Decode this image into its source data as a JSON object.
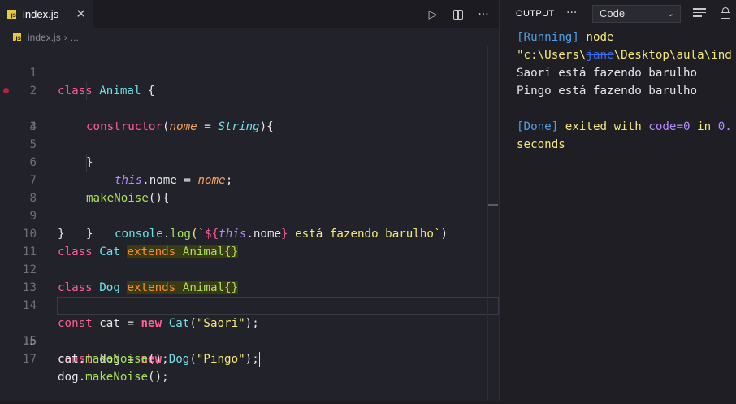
{
  "editor": {
    "tab": {
      "title": "index.js",
      "icon": "JS",
      "close": "✕"
    },
    "actions": {
      "run": "▷",
      "more": "···"
    },
    "breadcrumb": {
      "file": "index.js",
      "sep": "›",
      "trail": "..."
    },
    "line_numbers": [
      "1",
      "2",
      "3",
      "4",
      "5",
      "6",
      "7",
      "8",
      "9",
      "10",
      "11",
      "12",
      "13",
      "14",
      "15",
      "16",
      "17"
    ]
  },
  "code": {
    "l1": [
      "class",
      " ",
      "Animal",
      " {"
    ],
    "l2": [
      "constructor",
      "(",
      "nome",
      " = ",
      "String",
      "){"
    ],
    "l3": [
      "this",
      ".nome = ",
      "nome",
      ";"
    ],
    "l4": [
      "}"
    ],
    "l6": [
      "makeNoise",
      "(){"
    ],
    "l7": [
      "console",
      ".",
      "log",
      "(`",
      "${",
      "this",
      ".nome",
      "}",
      " está fazendo barulho`",
      ")"
    ],
    "l8": [
      "}"
    ],
    "l9": [
      "}"
    ],
    "l10": [
      "class",
      " ",
      "Cat",
      " ",
      "extends",
      " ",
      "Animal",
      "{}"
    ],
    "l12": [
      "class",
      " ",
      "Dog",
      " ",
      "extends",
      " ",
      "Animal",
      "{}"
    ],
    "l14": [
      "const",
      " ",
      "cat",
      " = ",
      "new",
      " ",
      "Cat",
      "(",
      "\"Saori\"",
      ");"
    ],
    "l15": [
      "const",
      " ",
      "dog",
      " = ",
      "new",
      " ",
      "Dog",
      "(",
      "\"Pingo\"",
      ");"
    ],
    "l16": [
      "cat",
      ".",
      "makeNoise",
      "();"
    ],
    "l17": [
      "dog",
      ".",
      "makeNoise",
      "();"
    ]
  },
  "output": {
    "tab_label": "OUTPUT",
    "more": "···",
    "channel": "Code",
    "running_tag": "[Running]",
    "running_cmd": " node",
    "path_start": "\"c:\\Users\\",
    "path_redacted": "jane",
    "path_end": "\\Desktop\\aula\\ind",
    "log1": "Saori está fazendo barulho",
    "log2": "Pingo está fazendo barulho",
    "done_tag": "[Done]",
    "done_mid": " exited with ",
    "done_code": "code=0",
    "done_in": " in ",
    "done_num": "0.",
    "done_unit": "seconds"
  }
}
